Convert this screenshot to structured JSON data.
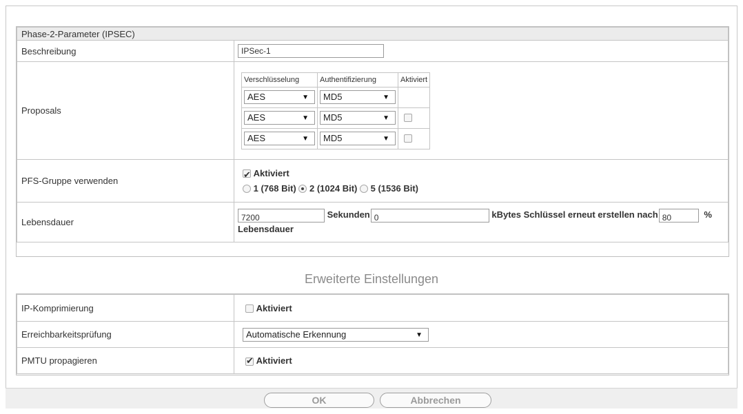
{
  "phase2": {
    "header": "Phase-2-Parameter (IPSEC)",
    "beschreibung": {
      "label": "Beschreibung",
      "value": "IPSec-1"
    },
    "proposals": {
      "label": "Proposals",
      "columns": [
        "Verschlüsselung",
        "Authentifizierung",
        "Aktiviert"
      ],
      "rows": [
        {
          "encryption": "AES",
          "auth": "MD5",
          "active": null
        },
        {
          "encryption": "AES",
          "auth": "MD5",
          "active": false
        },
        {
          "encryption": "AES",
          "auth": "MD5",
          "active": false
        }
      ]
    },
    "pfs": {
      "label": "PFS-Gruppe verwenden",
      "checkbox_label": "Aktiviert",
      "checked": true,
      "options": [
        "1 (768 Bit)",
        "2 (1024 Bit)",
        "5 (1536 Bit)"
      ],
      "selected": "2 (1024 Bit)"
    },
    "lebensdauer": {
      "label": "Lebensdauer",
      "seconds_value": "7200",
      "seconds_unit": "Sekunden",
      "kbytes_value": "0",
      "kbytes_text": "kBytes Schlüssel erneut erstellen nach",
      "percent_value": "80",
      "percent_sign": "%",
      "suffix": "Lebensdauer"
    }
  },
  "advanced": {
    "title": "Erweiterte Einstellungen",
    "ip_kompr": {
      "label": "IP-Komprimierung",
      "checkbox_label": "Aktiviert",
      "checked": false
    },
    "erreich": {
      "label": "Erreichbarkeitsprüfung",
      "value": "Automatische Erkennung"
    },
    "pmtu": {
      "label": "PMTU propagieren",
      "checkbox_label": "Aktiviert",
      "checked": true
    }
  },
  "buttons": {
    "ok": "OK",
    "cancel": "Abbrechen"
  },
  "icons": {
    "dropdown": "dropdown-arrow-icon",
    "check": "checkmark-icon",
    "radio": "radio-dot-icon"
  }
}
